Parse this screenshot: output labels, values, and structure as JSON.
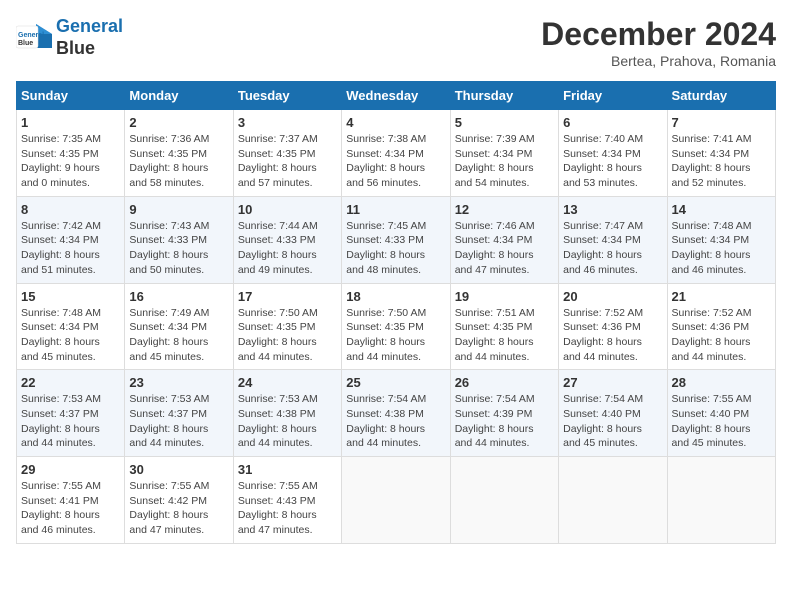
{
  "header": {
    "logo_line1": "General",
    "logo_line2": "Blue",
    "month": "December 2024",
    "location": "Bertea, Prahova, Romania"
  },
  "weekdays": [
    "Sunday",
    "Monday",
    "Tuesday",
    "Wednesday",
    "Thursday",
    "Friday",
    "Saturday"
  ],
  "weeks": [
    [
      {
        "day": "1",
        "detail": "Sunrise: 7:35 AM\nSunset: 4:35 PM\nDaylight: 9 hours\nand 0 minutes."
      },
      {
        "day": "2",
        "detail": "Sunrise: 7:36 AM\nSunset: 4:35 PM\nDaylight: 8 hours\nand 58 minutes."
      },
      {
        "day": "3",
        "detail": "Sunrise: 7:37 AM\nSunset: 4:35 PM\nDaylight: 8 hours\nand 57 minutes."
      },
      {
        "day": "4",
        "detail": "Sunrise: 7:38 AM\nSunset: 4:34 PM\nDaylight: 8 hours\nand 56 minutes."
      },
      {
        "day": "5",
        "detail": "Sunrise: 7:39 AM\nSunset: 4:34 PM\nDaylight: 8 hours\nand 54 minutes."
      },
      {
        "day": "6",
        "detail": "Sunrise: 7:40 AM\nSunset: 4:34 PM\nDaylight: 8 hours\nand 53 minutes."
      },
      {
        "day": "7",
        "detail": "Sunrise: 7:41 AM\nSunset: 4:34 PM\nDaylight: 8 hours\nand 52 minutes."
      }
    ],
    [
      {
        "day": "8",
        "detail": "Sunrise: 7:42 AM\nSunset: 4:34 PM\nDaylight: 8 hours\nand 51 minutes."
      },
      {
        "day": "9",
        "detail": "Sunrise: 7:43 AM\nSunset: 4:33 PM\nDaylight: 8 hours\nand 50 minutes."
      },
      {
        "day": "10",
        "detail": "Sunrise: 7:44 AM\nSunset: 4:33 PM\nDaylight: 8 hours\nand 49 minutes."
      },
      {
        "day": "11",
        "detail": "Sunrise: 7:45 AM\nSunset: 4:33 PM\nDaylight: 8 hours\nand 48 minutes."
      },
      {
        "day": "12",
        "detail": "Sunrise: 7:46 AM\nSunset: 4:34 PM\nDaylight: 8 hours\nand 47 minutes."
      },
      {
        "day": "13",
        "detail": "Sunrise: 7:47 AM\nSunset: 4:34 PM\nDaylight: 8 hours\nand 46 minutes."
      },
      {
        "day": "14",
        "detail": "Sunrise: 7:48 AM\nSunset: 4:34 PM\nDaylight: 8 hours\nand 46 minutes."
      }
    ],
    [
      {
        "day": "15",
        "detail": "Sunrise: 7:48 AM\nSunset: 4:34 PM\nDaylight: 8 hours\nand 45 minutes."
      },
      {
        "day": "16",
        "detail": "Sunrise: 7:49 AM\nSunset: 4:34 PM\nDaylight: 8 hours\nand 45 minutes."
      },
      {
        "day": "17",
        "detail": "Sunrise: 7:50 AM\nSunset: 4:35 PM\nDaylight: 8 hours\nand 44 minutes."
      },
      {
        "day": "18",
        "detail": "Sunrise: 7:50 AM\nSunset: 4:35 PM\nDaylight: 8 hours\nand 44 minutes."
      },
      {
        "day": "19",
        "detail": "Sunrise: 7:51 AM\nSunset: 4:35 PM\nDaylight: 8 hours\nand 44 minutes."
      },
      {
        "day": "20",
        "detail": "Sunrise: 7:52 AM\nSunset: 4:36 PM\nDaylight: 8 hours\nand 44 minutes."
      },
      {
        "day": "21",
        "detail": "Sunrise: 7:52 AM\nSunset: 4:36 PM\nDaylight: 8 hours\nand 44 minutes."
      }
    ],
    [
      {
        "day": "22",
        "detail": "Sunrise: 7:53 AM\nSunset: 4:37 PM\nDaylight: 8 hours\nand 44 minutes."
      },
      {
        "day": "23",
        "detail": "Sunrise: 7:53 AM\nSunset: 4:37 PM\nDaylight: 8 hours\nand 44 minutes."
      },
      {
        "day": "24",
        "detail": "Sunrise: 7:53 AM\nSunset: 4:38 PM\nDaylight: 8 hours\nand 44 minutes."
      },
      {
        "day": "25",
        "detail": "Sunrise: 7:54 AM\nSunset: 4:38 PM\nDaylight: 8 hours\nand 44 minutes."
      },
      {
        "day": "26",
        "detail": "Sunrise: 7:54 AM\nSunset: 4:39 PM\nDaylight: 8 hours\nand 44 minutes."
      },
      {
        "day": "27",
        "detail": "Sunrise: 7:54 AM\nSunset: 4:40 PM\nDaylight: 8 hours\nand 45 minutes."
      },
      {
        "day": "28",
        "detail": "Sunrise: 7:55 AM\nSunset: 4:40 PM\nDaylight: 8 hours\nand 45 minutes."
      }
    ],
    [
      {
        "day": "29",
        "detail": "Sunrise: 7:55 AM\nSunset: 4:41 PM\nDaylight: 8 hours\nand 46 minutes."
      },
      {
        "day": "30",
        "detail": "Sunrise: 7:55 AM\nSunset: 4:42 PM\nDaylight: 8 hours\nand 47 minutes."
      },
      {
        "day": "31",
        "detail": "Sunrise: 7:55 AM\nSunset: 4:43 PM\nDaylight: 8 hours\nand 47 minutes."
      },
      {
        "day": "",
        "detail": ""
      },
      {
        "day": "",
        "detail": ""
      },
      {
        "day": "",
        "detail": ""
      },
      {
        "day": "",
        "detail": ""
      }
    ]
  ]
}
